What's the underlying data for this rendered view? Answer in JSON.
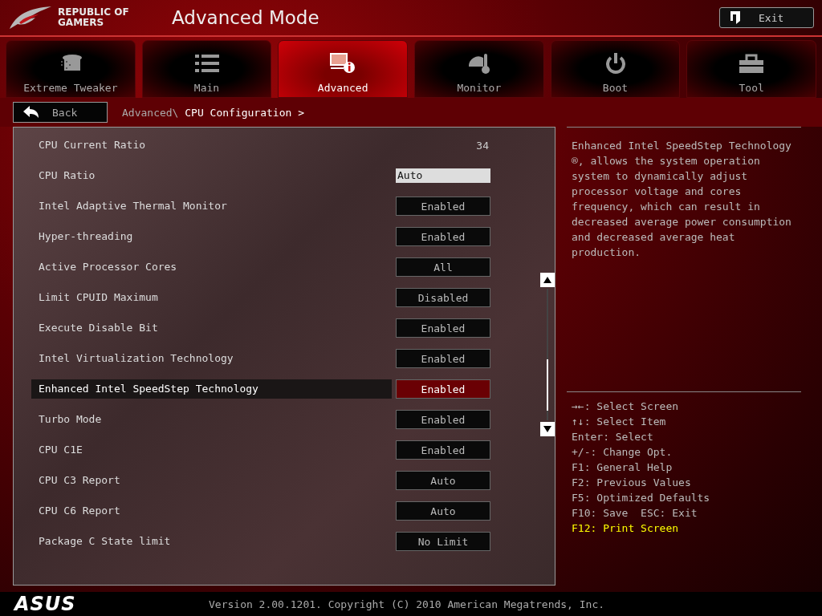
{
  "brand": {
    "line_1": "REPUBLIC OF",
    "line_2": "GAMERS"
  },
  "window": {
    "title": "Advanced Mode"
  },
  "exit_button": {
    "label": "Exit"
  },
  "tabs": [
    {
      "label": "Extreme Tweaker",
      "selected": false
    },
    {
      "label": "Main",
      "selected": false
    },
    {
      "label": "Advanced",
      "selected": true
    },
    {
      "label": "Monitor",
      "selected": false
    },
    {
      "label": "Boot",
      "selected": false
    },
    {
      "label": "Tool",
      "selected": false
    }
  ],
  "back_button": {
    "label": "Back"
  },
  "breadcrumb": {
    "parent": "Advanced\\",
    "current": "CPU Configuration >"
  },
  "settings": [
    {
      "kind": "readonly",
      "label": "CPU Current Ratio",
      "value": "34",
      "selected": false
    },
    {
      "kind": "input",
      "label": "CPU Ratio",
      "value": "Auto",
      "selected": false
    },
    {
      "kind": "option",
      "label": "Intel Adaptive Thermal Monitor",
      "value": "Enabled",
      "selected": false
    },
    {
      "kind": "option",
      "label": "Hyper-threading",
      "value": "Enabled",
      "selected": false
    },
    {
      "kind": "option",
      "label": "Active Processor Cores",
      "value": "All",
      "selected": false
    },
    {
      "kind": "option",
      "label": "Limit CPUID Maximum",
      "value": "Disabled",
      "selected": false
    },
    {
      "kind": "option",
      "label": "Execute Disable Bit",
      "value": "Enabled",
      "selected": false
    },
    {
      "kind": "option",
      "label": "Intel Virtualization Technology",
      "value": "Enabled",
      "selected": false
    },
    {
      "kind": "option",
      "label": "Enhanced Intel SpeedStep Technology",
      "value": "Enabled",
      "selected": true
    },
    {
      "kind": "option",
      "label": "Turbo Mode",
      "value": "Enabled",
      "selected": false
    },
    {
      "kind": "option",
      "label": "CPU C1E",
      "value": "Enabled",
      "selected": false
    },
    {
      "kind": "option",
      "label": "CPU C3 Report",
      "value": "Auto",
      "selected": false
    },
    {
      "kind": "option",
      "label": "CPU C6 Report",
      "value": "Auto",
      "selected": false
    },
    {
      "kind": "option",
      "label": "Package C State limit",
      "value": "No Limit",
      "selected": false
    }
  ],
  "help_text": "Enhanced Intel SpeedStep Technology ®, allows the system operation system to dynamically adjust processor voltage and cores frequency, which can result in decreased average power consumption and decreased average heat production.",
  "key_help": [
    {
      "text": "→←: Select Screen",
      "highlighted": false
    },
    {
      "text": "↑↓: Select Item",
      "highlighted": false
    },
    {
      "text": "Enter: Select",
      "highlighted": false
    },
    {
      "text": "+/-: Change Opt.",
      "highlighted": false
    },
    {
      "text": "F1: General Help",
      "highlighted": false
    },
    {
      "text": "F2: Previous Values",
      "highlighted": false
    },
    {
      "text": "F5: Optimized Defaults",
      "highlighted": false
    },
    {
      "text": "F10: Save  ESC: Exit",
      "highlighted": false
    },
    {
      "text": "F12: Print Screen",
      "highlighted": true
    }
  ],
  "footer": {
    "logo": "ASUS",
    "version": "Version 2.00.1201. Copyright (C) 2010 American Megatrends, Inc."
  }
}
